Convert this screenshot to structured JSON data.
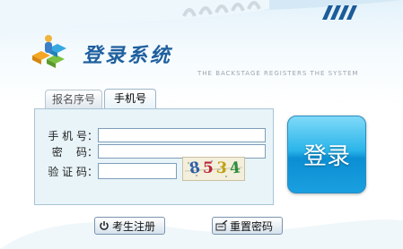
{
  "logo": {
    "title": "登录系统",
    "subtitle": "THE BACKSTAGE REGISTERS THE SYSTEM"
  },
  "tabs": [
    {
      "label": "报名序号",
      "active": false
    },
    {
      "label": "手机号",
      "active": true
    }
  ],
  "form": {
    "phone_label": "手 机 号：",
    "phone_value": "",
    "password_label": "密    码：",
    "password_value": "",
    "captcha_label": "验 证 码：",
    "captcha_value": "",
    "captcha_chars": [
      "8",
      "5",
      "3",
      "4"
    ]
  },
  "buttons": {
    "login": "登录",
    "register": "考生注册",
    "reset_password": "重置密码"
  },
  "colors": {
    "accent": "#1a9fe0",
    "title": "#1e5f9e"
  },
  "icons": {
    "register": "power-icon",
    "reset_password": "keyboard-pen-icon"
  }
}
